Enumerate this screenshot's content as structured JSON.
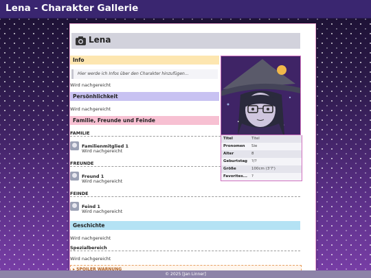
{
  "window": {
    "title": "Lena - Charakter Gallerie"
  },
  "character": {
    "name": "Lena"
  },
  "sections": {
    "info": {
      "title": "Info",
      "quote": "Hier werde ich Infos über den Charakter hinzufügen...",
      "text": "Wird nachgereicht",
      "color": "#fde6b0"
    },
    "personality": {
      "title": "Persönhlichkeit",
      "text": "Wird nachgereicht",
      "color": "#c8c2f2"
    },
    "family": {
      "title": "Familie, Freunde und Feinde",
      "color": "#f7c0d2",
      "familie_label": "FAMILIE",
      "freunde_label": "FREUNDE",
      "feinde_label": "FEINDE",
      "familie": {
        "name": "Familienmitglied 1",
        "status": "Wird nachgereicht"
      },
      "freund": {
        "name": "Freund 1",
        "status": "Wird nachgereicht"
      },
      "feind": {
        "name": "Feind 1",
        "status": "Wird nachgereicht"
      }
    },
    "history": {
      "title": "Geschichte",
      "text": "Wird nachgereicht",
      "color": "#b4e2f4"
    },
    "special": {
      "label": "Spezialbereich",
      "text": "Wird nachgereicht"
    },
    "spoiler": {
      "label": "▸ SPOILER WARNUNG"
    }
  },
  "infobox": [
    {
      "key": "Titel",
      "value": "Titel"
    },
    {
      "key": "Pronomen",
      "value": "Sie"
    },
    {
      "key": "Alter",
      "value": "8"
    },
    {
      "key": "Geburtstag",
      "value": "?/?"
    },
    {
      "key": "Größe",
      "value": "100cm (3'7')"
    },
    {
      "key": "Favorites...",
      "value": "?"
    }
  ],
  "footer": {
    "text": "© 2025 [Jan Linner]"
  },
  "icons": {
    "header": "camera-icon",
    "avatar": "user-avatar-icon"
  }
}
